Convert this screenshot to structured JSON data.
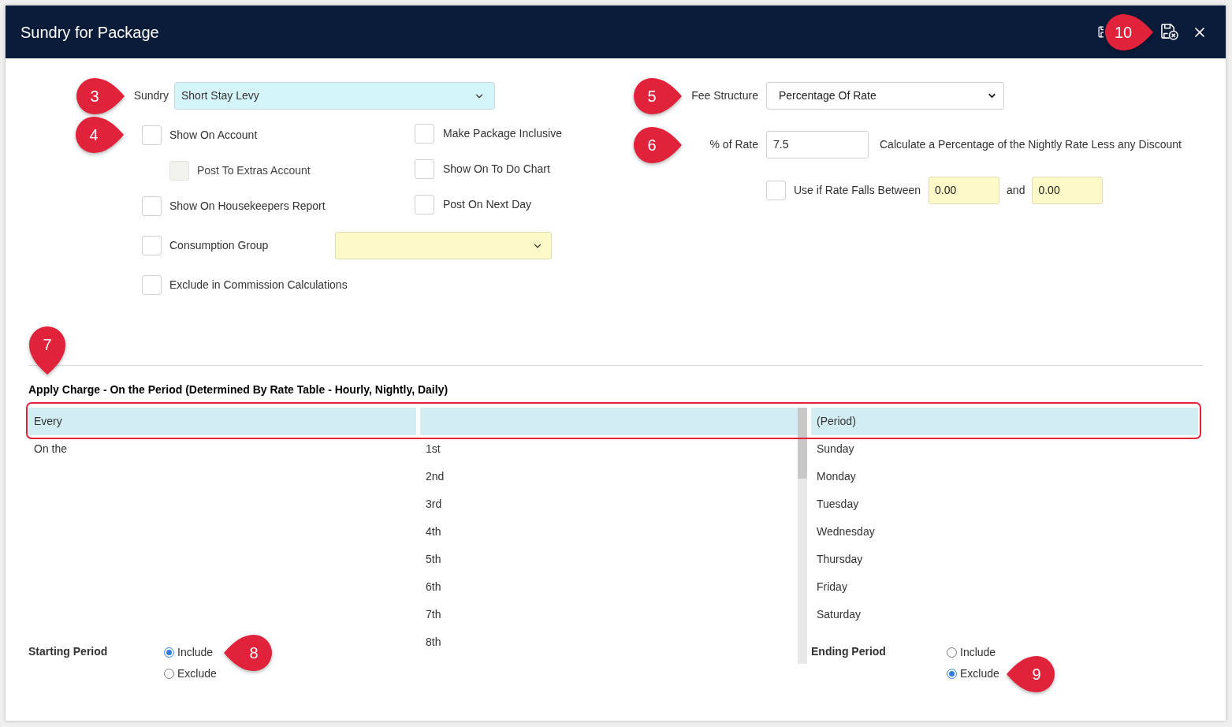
{
  "window": {
    "title": "Sundry for Package",
    "callout": "10"
  },
  "sundry": {
    "label": "Sundry",
    "value": "Short Stay Levy",
    "callout": "3"
  },
  "options": {
    "callout": "4",
    "left": [
      {
        "kind": "checkbox",
        "label": "Show On Account",
        "checked": false,
        "disabled": false,
        "children": [
          {
            "label": "Post To Extras Account",
            "checked": false,
            "disabled": true
          }
        ]
      },
      {
        "kind": "checkbox",
        "label": "Show On Housekeepers Report",
        "checked": false,
        "disabled": false
      },
      {
        "kind": "checkbox-select",
        "label": "Consumption Group",
        "checked": false,
        "disabled": false
      },
      {
        "kind": "checkbox",
        "label": "Exclude in Commission Calculations",
        "checked": false,
        "disabled": false
      }
    ],
    "right": [
      {
        "label": "Make Package Inclusive",
        "checked": false,
        "disabled": false
      },
      {
        "label": "Show On To Do Chart",
        "checked": false,
        "disabled": false
      },
      {
        "label": "Post On Next Day",
        "checked": false,
        "disabled": false
      }
    ]
  },
  "fee_structure": {
    "label": "Fee Structure",
    "value": "Percentage Of Rate",
    "callout": "5"
  },
  "percent_of_rate": {
    "label": "% of Rate",
    "value": "7.5",
    "note": "Calculate a Percentage of the Nightly Rate Less any Discount",
    "callout": "6"
  },
  "rate_range": {
    "label": "Use if Rate Falls Between",
    "checked": false,
    "from": "0.00",
    "joiner": "and",
    "to": "0.00"
  },
  "apply_charge": {
    "title": "Apply Charge - On the Period (Determined By Rate Table - Hourly, Nightly, Daily)",
    "callout": "7",
    "lists": [
      {
        "items": [
          {
            "label": "Every",
            "selected": true
          },
          {
            "label": "On the",
            "selected": false
          }
        ]
      },
      {
        "items": [
          {
            "selected": true
          },
          {
            "label": "1st",
            "selected": false
          },
          {
            "label": "2nd",
            "selected": false
          },
          {
            "label": "3rd",
            "selected": false
          },
          {
            "label": "4th",
            "selected": false
          },
          {
            "label": "5th",
            "selected": false
          },
          {
            "label": "6th",
            "selected": false
          },
          {
            "label": "7th",
            "selected": false
          },
          {
            "label": "8th",
            "selected": false
          }
        ]
      },
      {
        "items": [
          {
            "label": "(Period)",
            "selected": true
          },
          {
            "label": "Sunday",
            "selected": false
          },
          {
            "label": "Monday",
            "selected": false
          },
          {
            "label": "Tuesday",
            "selected": false
          },
          {
            "label": "Wednesday",
            "selected": false
          },
          {
            "label": "Thursday",
            "selected": false
          },
          {
            "label": "Friday",
            "selected": false
          },
          {
            "label": "Saturday",
            "selected": false
          }
        ]
      }
    ],
    "starting_period": {
      "label": "Starting Period",
      "options": [
        {
          "label": "Include",
          "selected": true,
          "callout": "8"
        },
        {
          "label": "Exclude",
          "selected": false
        }
      ]
    },
    "ending_period": {
      "label": "Ending Period",
      "options": [
        {
          "label": "Include",
          "selected": false
        },
        {
          "label": "Exclude",
          "selected": true,
          "callout": "9"
        }
      ]
    }
  }
}
